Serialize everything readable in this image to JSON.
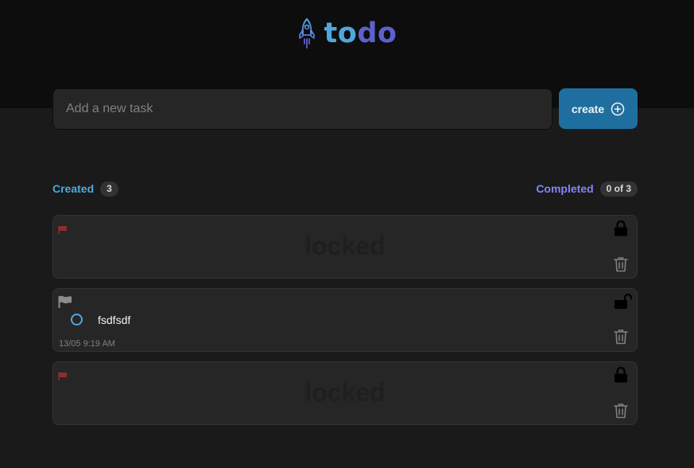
{
  "app": {
    "title_part1": "to",
    "title_part2": "do"
  },
  "new_task": {
    "placeholder": "Add a new task",
    "value": ""
  },
  "create_button": {
    "label": "create"
  },
  "counters": {
    "created_label": "Created",
    "created_count": "3",
    "completed_label": "Completed",
    "completed_count": "0 of 3"
  },
  "tasks": [
    {
      "status": "locked",
      "locked_text": "locked",
      "flag_color": "#8b2e2e"
    },
    {
      "status": "unlocked",
      "text": "fsdfsdf",
      "date": "13/05 9:19 AM",
      "completed": false,
      "flag_color": "#8c8c8c"
    },
    {
      "status": "locked",
      "locked_text": "locked",
      "flag_color": "#8b2e2e"
    }
  ],
  "colors": {
    "header_bg": "#0d0d0d",
    "page_bg": "#1a1a1a",
    "card_bg": "#262626",
    "blue": "#4ea8de",
    "purple": "#8284fa",
    "button_bg": "#1e6f9f"
  },
  "icons": {
    "logo": "rocket-icon",
    "create": "plus-circle-icon",
    "locked": "lock-icon",
    "unlocked": "unlock-icon",
    "delete": "trash-icon",
    "priority": "flag-icon",
    "checkbox": "circle-icon"
  }
}
